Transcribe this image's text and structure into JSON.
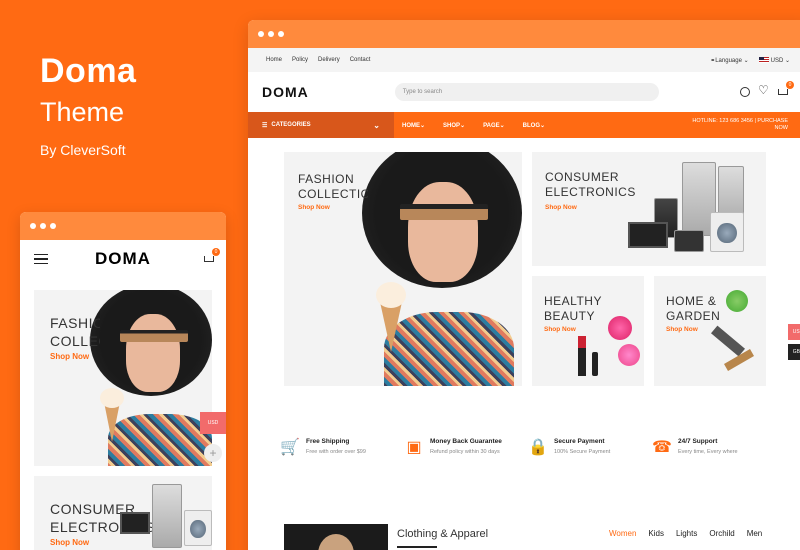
{
  "promo": {
    "brand": "Doma",
    "theme": "Theme",
    "by": "By CleverSoft"
  },
  "desktop": {
    "topbar": {
      "links": [
        "Home",
        "Policy",
        "Delivery",
        "Contact"
      ],
      "language": "Language",
      "currency": "USD"
    },
    "logo": "DOMA",
    "search_placeholder": "Type to search",
    "cart_count": "0",
    "nav": {
      "categories": "CATEGORIES",
      "menu": [
        "HOME",
        "SHOP",
        "PAGE",
        "BLOG"
      ],
      "hotline": "HOTLINE: 123 686 3456 | PURCHASE NOW"
    },
    "banners": [
      {
        "title": "FASHION COLLECTION",
        "cta": "Shop Now"
      },
      {
        "title": "CONSUMER ELECTRONICS",
        "cta": "Shop Now"
      },
      {
        "title": "HEALTHY BEAUTY",
        "cta": "Shop Now"
      },
      {
        "title": "HOME & GARDEN",
        "cta": "Shop Now"
      }
    ],
    "features": [
      {
        "icon": "cart-icon",
        "title": "Free Shipping",
        "sub": "Free with order over $99"
      },
      {
        "icon": "wallet-icon",
        "title": "Money Back Guarantee",
        "sub": "Refund policy within 30 days"
      },
      {
        "icon": "lock-icon",
        "title": "Secure Payment",
        "sub": "100% Secure Payment"
      },
      {
        "icon": "headset-icon",
        "title": "24/7 Support",
        "sub": "Every time, Every where"
      }
    ],
    "section": {
      "title": "Clothing & Apparel",
      "tabs": [
        "Women",
        "Kids",
        "Lights",
        "Orchild",
        "Men"
      ]
    },
    "side_currencies": [
      "USD",
      "GBP"
    ],
    "colors": {
      "accent": "#ff6a13",
      "dark_accent": "#d8571b"
    }
  },
  "mobile": {
    "logo": "DOMA",
    "cart_count": "0",
    "banners": [
      {
        "title": "FASHION COLLECTION",
        "cta": "Shop Now"
      },
      {
        "title": "CONSUMER ELECTRONICS",
        "cta": "Shop Now"
      }
    ],
    "side_currency": "USD"
  }
}
